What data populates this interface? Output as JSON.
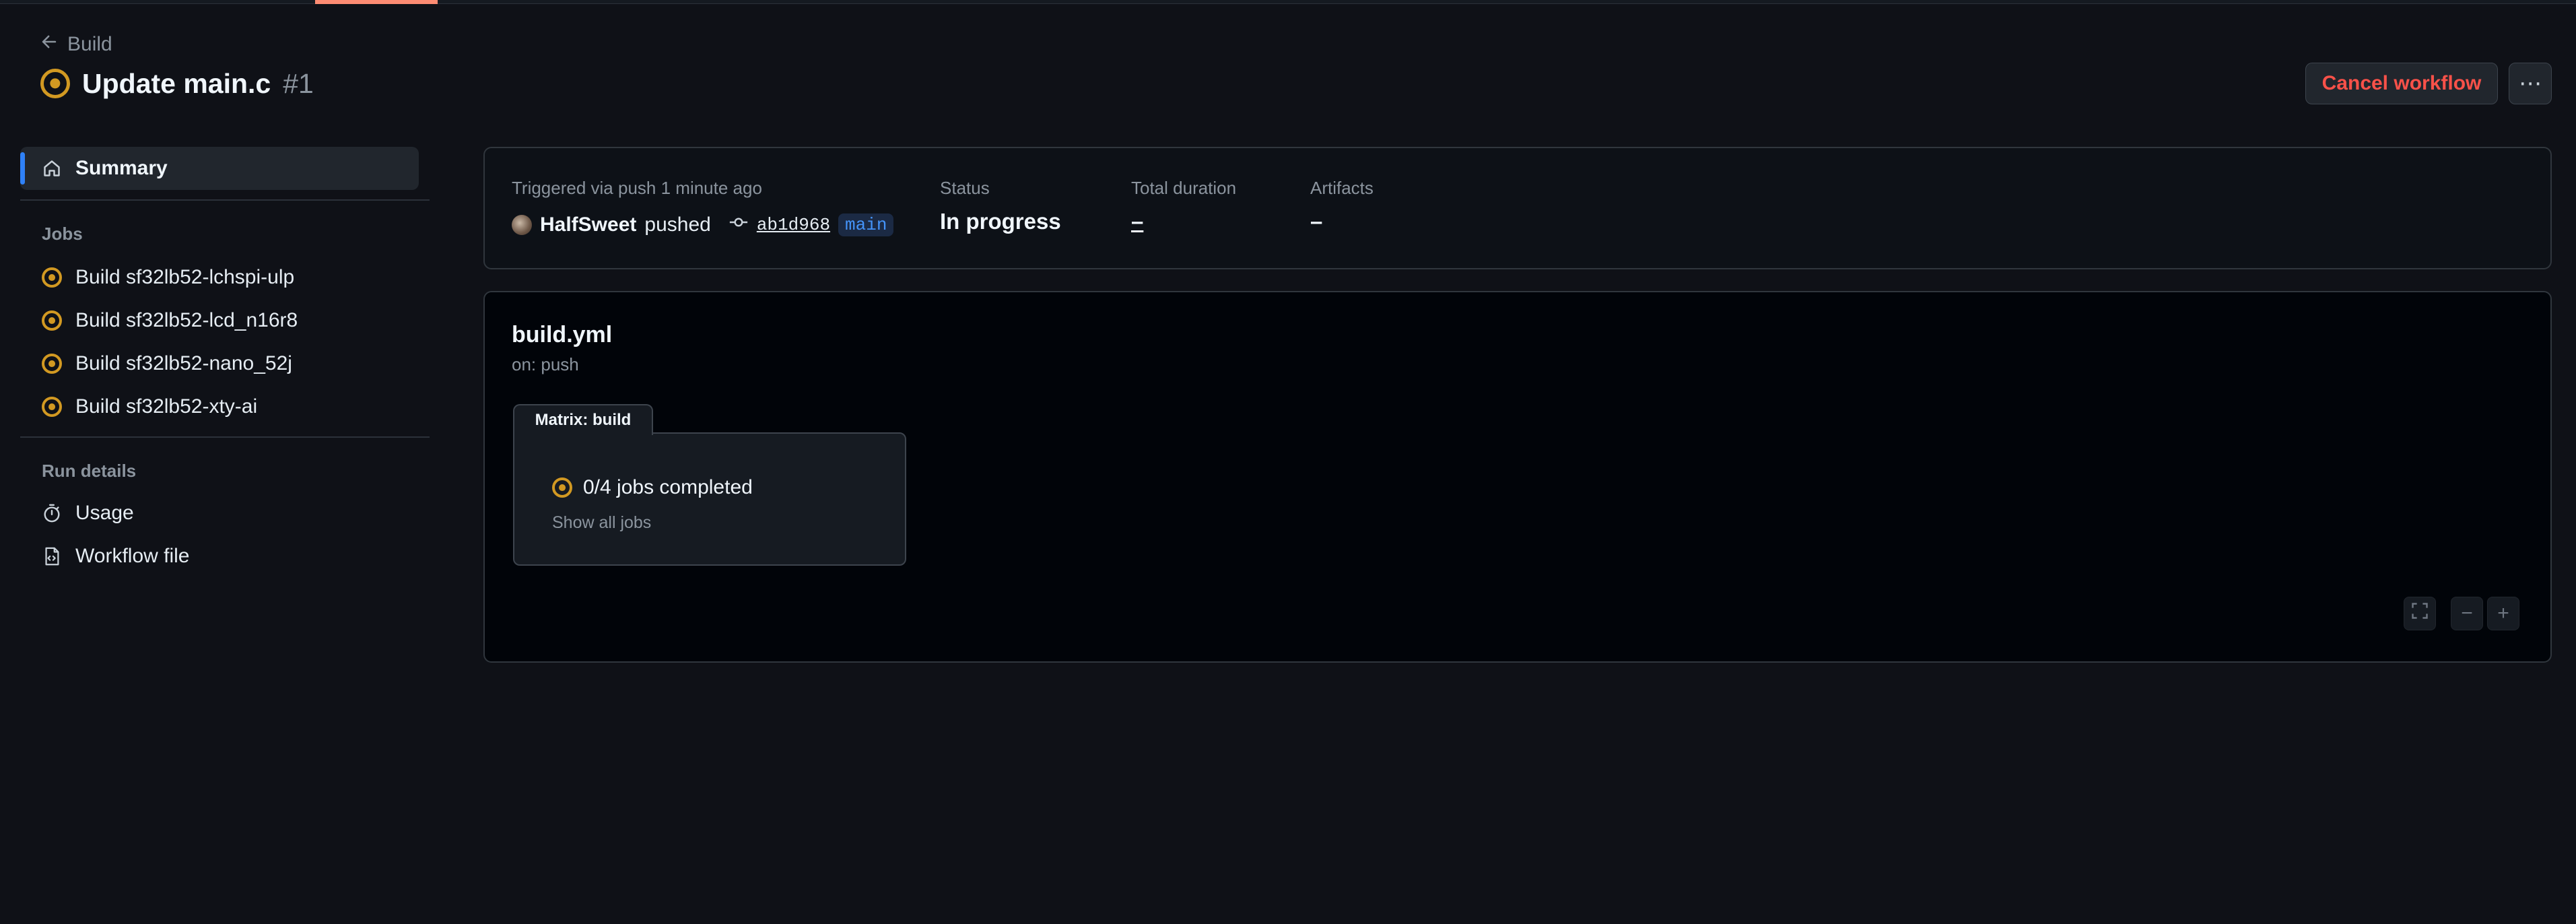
{
  "header": {
    "back_label": "Build",
    "title": "Update main.c",
    "run_number": "#1",
    "cancel_label": "Cancel workflow",
    "more_label": "⋯"
  },
  "sidebar": {
    "summary_label": "Summary",
    "jobs_heading": "Jobs",
    "jobs": [
      {
        "label": "Build sf32lb52-lchspi-ulp"
      },
      {
        "label": "Build sf32lb52-lcd_n16r8"
      },
      {
        "label": "Build sf32lb52-nano_52j"
      },
      {
        "label": "Build sf32lb52-xty-ai"
      }
    ],
    "run_details_heading": "Run details",
    "usage_label": "Usage",
    "workflow_file_label": "Workflow file"
  },
  "summary": {
    "trigger_label": "Triggered via push 1 minute ago",
    "actor": "HalfSweet",
    "action": "pushed",
    "commit": "ab1d968",
    "branch": "main",
    "status_label": "Status",
    "status_value": "In progress",
    "duration_label": "Total duration",
    "duration_value": "–",
    "artifacts_label": "Artifacts",
    "artifacts_value": "–"
  },
  "graph": {
    "workflow_name": "build.yml",
    "trigger": "on: push",
    "matrix_tab": "Matrix: build",
    "jobs_completed": "0/4 jobs completed",
    "show_all": "Show all jobs",
    "controls": {
      "fullscreen": "⛶",
      "zoom_out": "−",
      "zoom_in": "+"
    }
  },
  "colors": {
    "in_progress": "#d29922",
    "danger": "#f85149",
    "accent": "#2f81f7",
    "branch": "#4493f8"
  },
  "icons": [
    "arrow-left-icon",
    "status-in-progress-icon",
    "kebab-horizontal-icon",
    "home-icon",
    "stopwatch-icon",
    "file-code-icon",
    "git-commit-icon",
    "fullscreen-icon",
    "zoom-out-icon",
    "zoom-in-icon"
  ]
}
